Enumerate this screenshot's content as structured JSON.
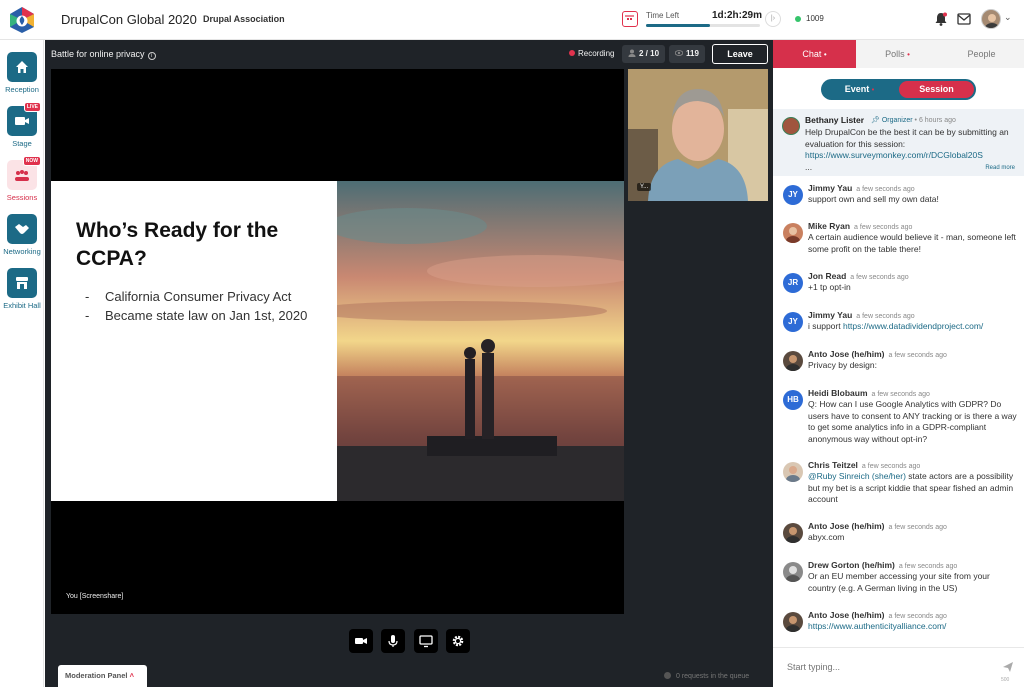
{
  "header": {
    "app_title": "DrupalCon Global 2020",
    "org": "Drupal Association",
    "time_left_label": "Time Left",
    "time_left_value": "1d:2h:29m",
    "time_progress": 0.56,
    "online_count": "1009"
  },
  "nav": [
    {
      "label": "Reception",
      "icon": "home-icon"
    },
    {
      "label": "Stage",
      "icon": "camera-icon",
      "badge": "LIVE"
    },
    {
      "label": "Sessions",
      "icon": "sessions-icon",
      "badge": "NOW"
    },
    {
      "label": "Networking",
      "icon": "handshake-icon"
    },
    {
      "label": "Exhibit Hall",
      "icon": "booth-icon"
    }
  ],
  "stage": {
    "title": "Battle for online privacy",
    "recording": "Recording",
    "speakers": "2 / 10",
    "viewers": "119",
    "leave": "Leave",
    "slide_title": "Who’s Ready for the CCPA?",
    "slide_bullets": [
      "California Consumer Privacy Act",
      "Became state law on Jan 1st, 2020"
    ],
    "screenshare_label": "You [Screenshare]",
    "cam_label": "Y...",
    "moderation_panel": "Moderation Panel",
    "queue_text": "0 requests in the queue"
  },
  "panel": {
    "tabs": [
      "Chat",
      "Polls",
      "People"
    ],
    "toggle": [
      "Event",
      "Session"
    ],
    "pinned": {
      "name": "Bethany Lister",
      "role": "Organizer",
      "time": "6 hours ago",
      "text": "Help DrupalCon be the best it can be by submitting an evaluation for this session:",
      "link": "https://www.surveymonkey.com/r/DCGlobal20S",
      "ellipsis": "...",
      "read_more": "Read more"
    },
    "messages": [
      {
        "name": "Jimmy Yau",
        "time": "a few seconds ago",
        "initials": "JY",
        "text": "support own and sell my own data!"
      },
      {
        "name": "Mike Ryan",
        "time": "a few seconds ago",
        "text": "A certain audience would believe it - man, someone left some profit on the table there!"
      },
      {
        "name": "Jon Read",
        "time": "a few seconds ago",
        "initials": "JR",
        "text": "+1 tp opt-in"
      },
      {
        "name": "Jimmy Yau",
        "time": "a few seconds ago",
        "initials": "JY",
        "text": "i support ",
        "link": "https://www.datadividendproject.com/"
      },
      {
        "name": "Anto Jose (he/him)",
        "time": "a few seconds ago",
        "text": "Privacy by design:"
      },
      {
        "name": "Heidi Blobaum",
        "time": "a few seconds ago",
        "initials": "HB",
        "text": "Q: How can I use Google Analytics with GDPR? Do users have to consent to ANY tracking or is there a way to get some analytics info in a GDPR-compliant anonymous way without opt-in?"
      },
      {
        "name": "Chris Teitzel",
        "time": "a few seconds ago",
        "mention": "@Ruby Sinreich (she/her)",
        "text": " state actors are a possibility but my bet is a script kiddie that spear fished an admin account"
      },
      {
        "name": "Anto Jose (he/him)",
        "time": "a few seconds ago",
        "text": "abyx.com"
      },
      {
        "name": "Drew Gorton (he/him)",
        "time": "a few seconds ago",
        "text": "Or an EU member accessing your site from your country (e.g. A German living in the US)"
      },
      {
        "name": "Anto Jose (he/him)",
        "time": "a few seconds ago",
        "link": "https://www.authenticityalliance.com/"
      }
    ],
    "compose_placeholder": "Start typing...",
    "char_count": "500"
  },
  "colors": {
    "brand": "#1c6a86",
    "accent": "#d6304b",
    "stage_bg": "#1f2328"
  }
}
